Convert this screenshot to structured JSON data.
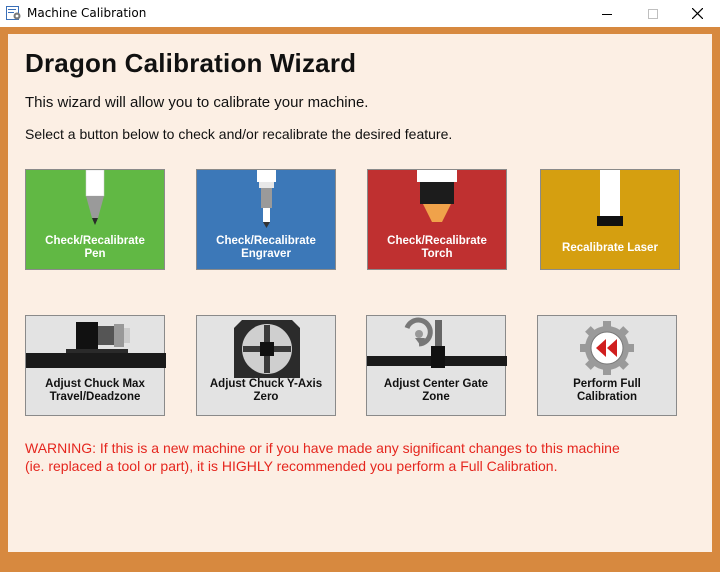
{
  "window": {
    "title": "Machine Calibration",
    "icon": "gear-document-icon"
  },
  "main": {
    "heading": "Dragon Calibration Wizard",
    "intro": "This wizard will allow you to calibrate your machine.",
    "instruction": "Select a button below to check and/or recalibrate the desired feature."
  },
  "tiles": {
    "pen": {
      "line1": "Check/Recalibrate",
      "line2": "Pen",
      "color": "#61b844"
    },
    "engraver": {
      "line1": "Check/Recalibrate",
      "line2": "Engraver",
      "color": "#3c78b8"
    },
    "torch": {
      "line1": "Check/Recalibrate",
      "line2": "Torch",
      "color": "#bf3030"
    },
    "laser": {
      "line1": "Recalibrate Laser",
      "color": "#d59f10"
    },
    "chuck_max": {
      "line1": "Adjust Chuck Max",
      "line2": "Travel/Deadzone"
    },
    "chuck_y": {
      "line1": "Adjust Chuck Y-Axis",
      "line2": "Zero"
    },
    "center_gate": {
      "line1": "Adjust Center Gate",
      "line2": "Zone"
    },
    "full": {
      "line1": "Perform Full",
      "line2": "Calibration"
    }
  },
  "warning": {
    "line1": "WARNING: If this is a new machine or if you have made any significant changes to this machine",
    "line2": "(ie. replaced a tool or part), it is HIGHLY recommended you perform a Full Calibration.",
    "color": "#e5261e"
  }
}
